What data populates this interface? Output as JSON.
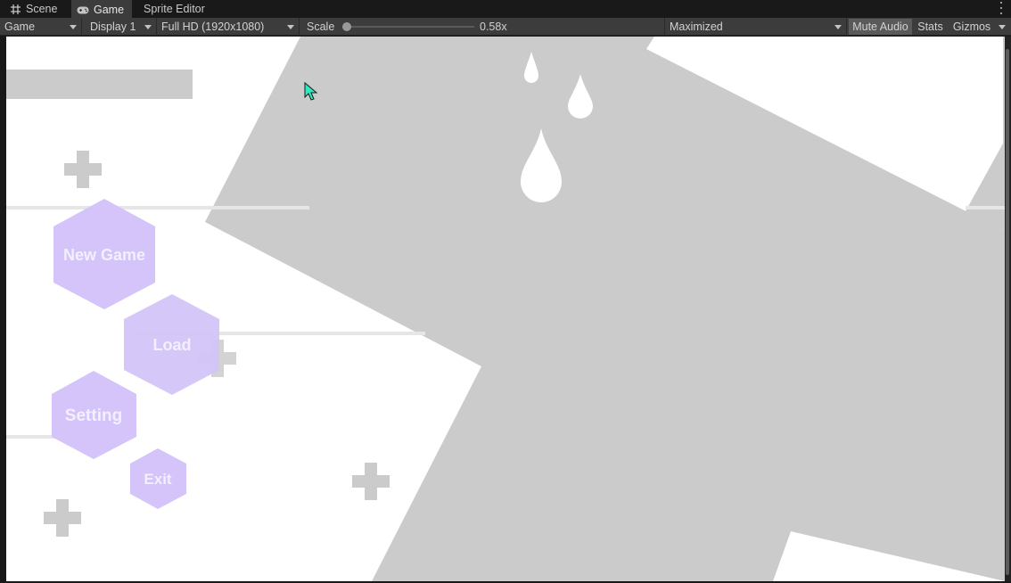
{
  "tabs": [
    {
      "label": "Scene",
      "icon": "grid-icon",
      "active": false
    },
    {
      "label": "Game",
      "icon": "gamepad-icon",
      "active": true
    },
    {
      "label": "Sprite Editor",
      "icon": "",
      "active": false
    }
  ],
  "toolbar": {
    "view_mode": "Game",
    "display": "Display 1",
    "resolution": "Full HD (1920x1080)",
    "scale_label": "Scale",
    "scale_value": "0.58x",
    "scale_fraction": 0.0,
    "play_mode": "Maximized",
    "mute_audio": "Mute Audio",
    "stats": "Stats",
    "gizmos": "Gizmos"
  },
  "game_menu": {
    "new_game": "New Game",
    "load": "Load",
    "setting": "Setting",
    "exit": "Exit"
  },
  "colors": {
    "hex_button": "#d4c4f9",
    "hex_text": "#f2f0ff",
    "shape_gray": "#cbcbcb",
    "background": "#ffffff",
    "cursor": "#2ee8c0"
  }
}
